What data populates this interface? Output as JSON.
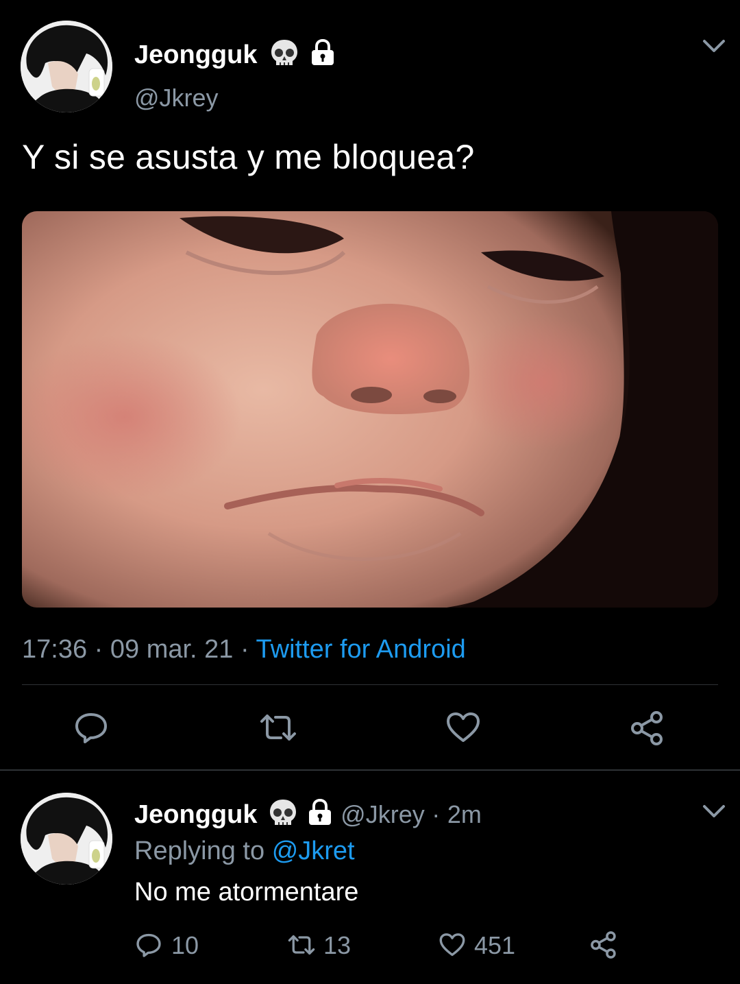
{
  "tweet": {
    "author_name": "Jeongguk",
    "author_handle": "@Jkrey",
    "text": "Y si se asusta y me bloquea?",
    "time": "17:36",
    "date": "09 mar. 21",
    "source": "Twitter for Android",
    "separator": "·",
    "media_alt": "sad baby face photo"
  },
  "reply": {
    "author_name": "Jeongguk",
    "author_handle": "@Jkrey",
    "time_ago": "2m",
    "replying_label": "Replying to",
    "replying_to": "@Jkret",
    "text": "No me atormentare",
    "reply_count": "10",
    "retweet_count": "13",
    "like_count": "451"
  },
  "icons": {
    "name_emoji": "skull-icon",
    "protected": "lock-icon",
    "more": "chevron-down-icon",
    "reply": "comment-icon",
    "retweet": "retweet-icon",
    "like": "heart-icon",
    "share": "share-icon"
  },
  "colors": {
    "background": "#000000",
    "text": "#ffffff",
    "secondary": "#8b98a5",
    "link": "#1d9bf0",
    "divider": "#2f3336"
  }
}
